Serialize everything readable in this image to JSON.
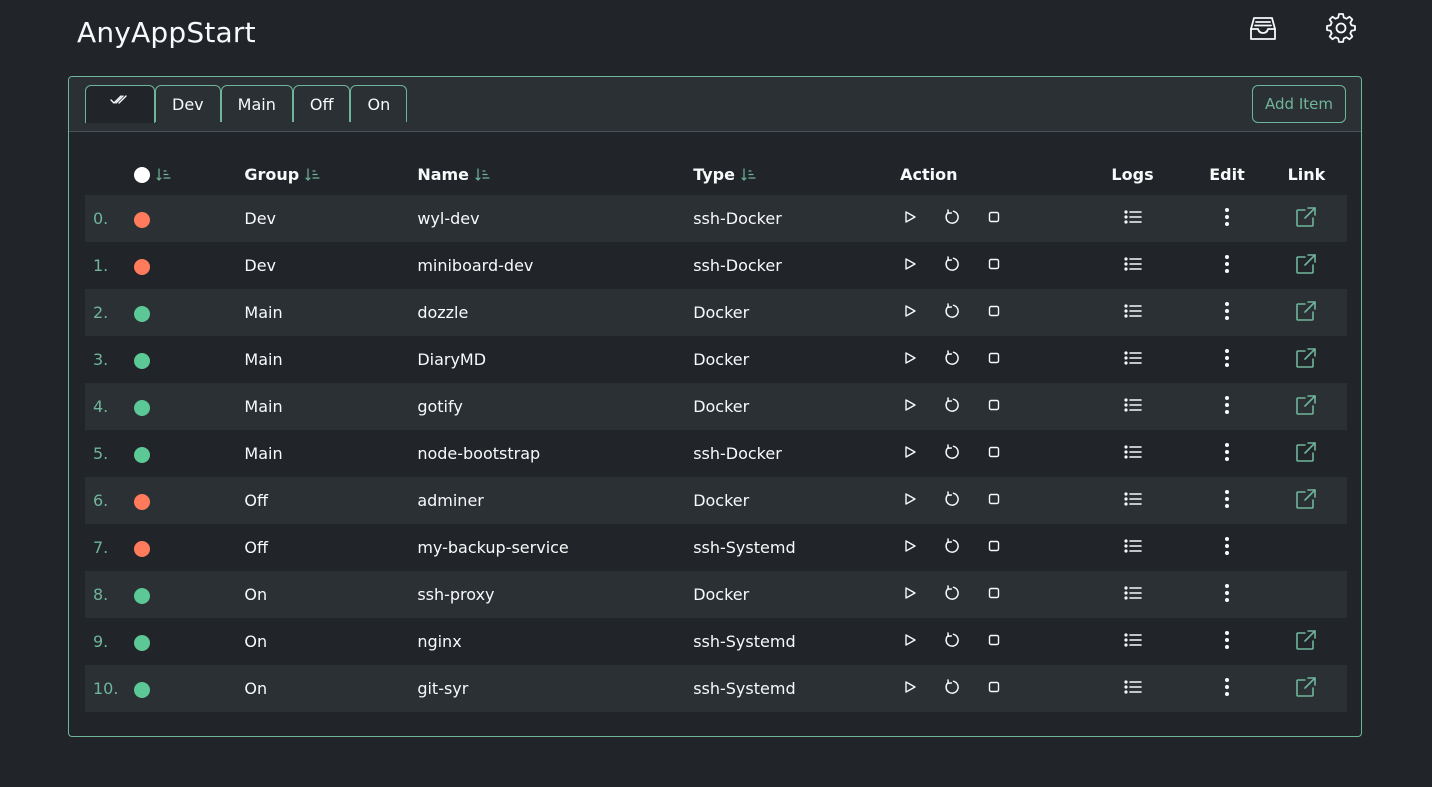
{
  "app": {
    "title": "AnyAppStart"
  },
  "toolbar": {
    "tabs": [
      {
        "label": "",
        "icon": "check-all-icon",
        "active": true
      },
      {
        "label": "Dev"
      },
      {
        "label": "Main"
      },
      {
        "label": "Off"
      },
      {
        "label": "On"
      }
    ],
    "add_label": "Add Item"
  },
  "table": {
    "headers": {
      "group": "Group",
      "name": "Name",
      "type": "Type",
      "action": "Action",
      "logs": "Logs",
      "edit": "Edit",
      "link": "Link"
    },
    "rows": [
      {
        "index": "0.",
        "status": "off",
        "group": "Dev",
        "name": "wyl-dev",
        "type": "ssh-Docker",
        "link": true
      },
      {
        "index": "1.",
        "status": "off",
        "group": "Dev",
        "name": "miniboard-dev",
        "type": "ssh-Docker",
        "link": true
      },
      {
        "index": "2.",
        "status": "on",
        "group": "Main",
        "name": "dozzle",
        "type": "Docker",
        "link": true
      },
      {
        "index": "3.",
        "status": "on",
        "group": "Main",
        "name": "DiaryMD",
        "type": "Docker",
        "link": true
      },
      {
        "index": "4.",
        "status": "on",
        "group": "Main",
        "name": "gotify",
        "type": "Docker",
        "link": true
      },
      {
        "index": "5.",
        "status": "on",
        "group": "Main",
        "name": "node-bootstrap",
        "type": "ssh-Docker",
        "link": true
      },
      {
        "index": "6.",
        "status": "off",
        "group": "Off",
        "name": "adminer",
        "type": "Docker",
        "link": true
      },
      {
        "index": "7.",
        "status": "off",
        "group": "Off",
        "name": "my-backup-service",
        "type": "ssh-Systemd",
        "link": false
      },
      {
        "index": "8.",
        "status": "on",
        "group": "On",
        "name": "ssh-proxy",
        "type": "Docker",
        "link": false
      },
      {
        "index": "9.",
        "status": "on",
        "group": "On",
        "name": "nginx",
        "type": "ssh-Systemd",
        "link": true
      },
      {
        "index": "10.",
        "status": "on",
        "group": "On",
        "name": "git-syr",
        "type": "ssh-Systemd",
        "link": true
      }
    ]
  },
  "colors": {
    "accent": "#6fb59a",
    "status_on": "#5bc895",
    "status_off": "#ff7b5c",
    "bg": "#212529"
  }
}
